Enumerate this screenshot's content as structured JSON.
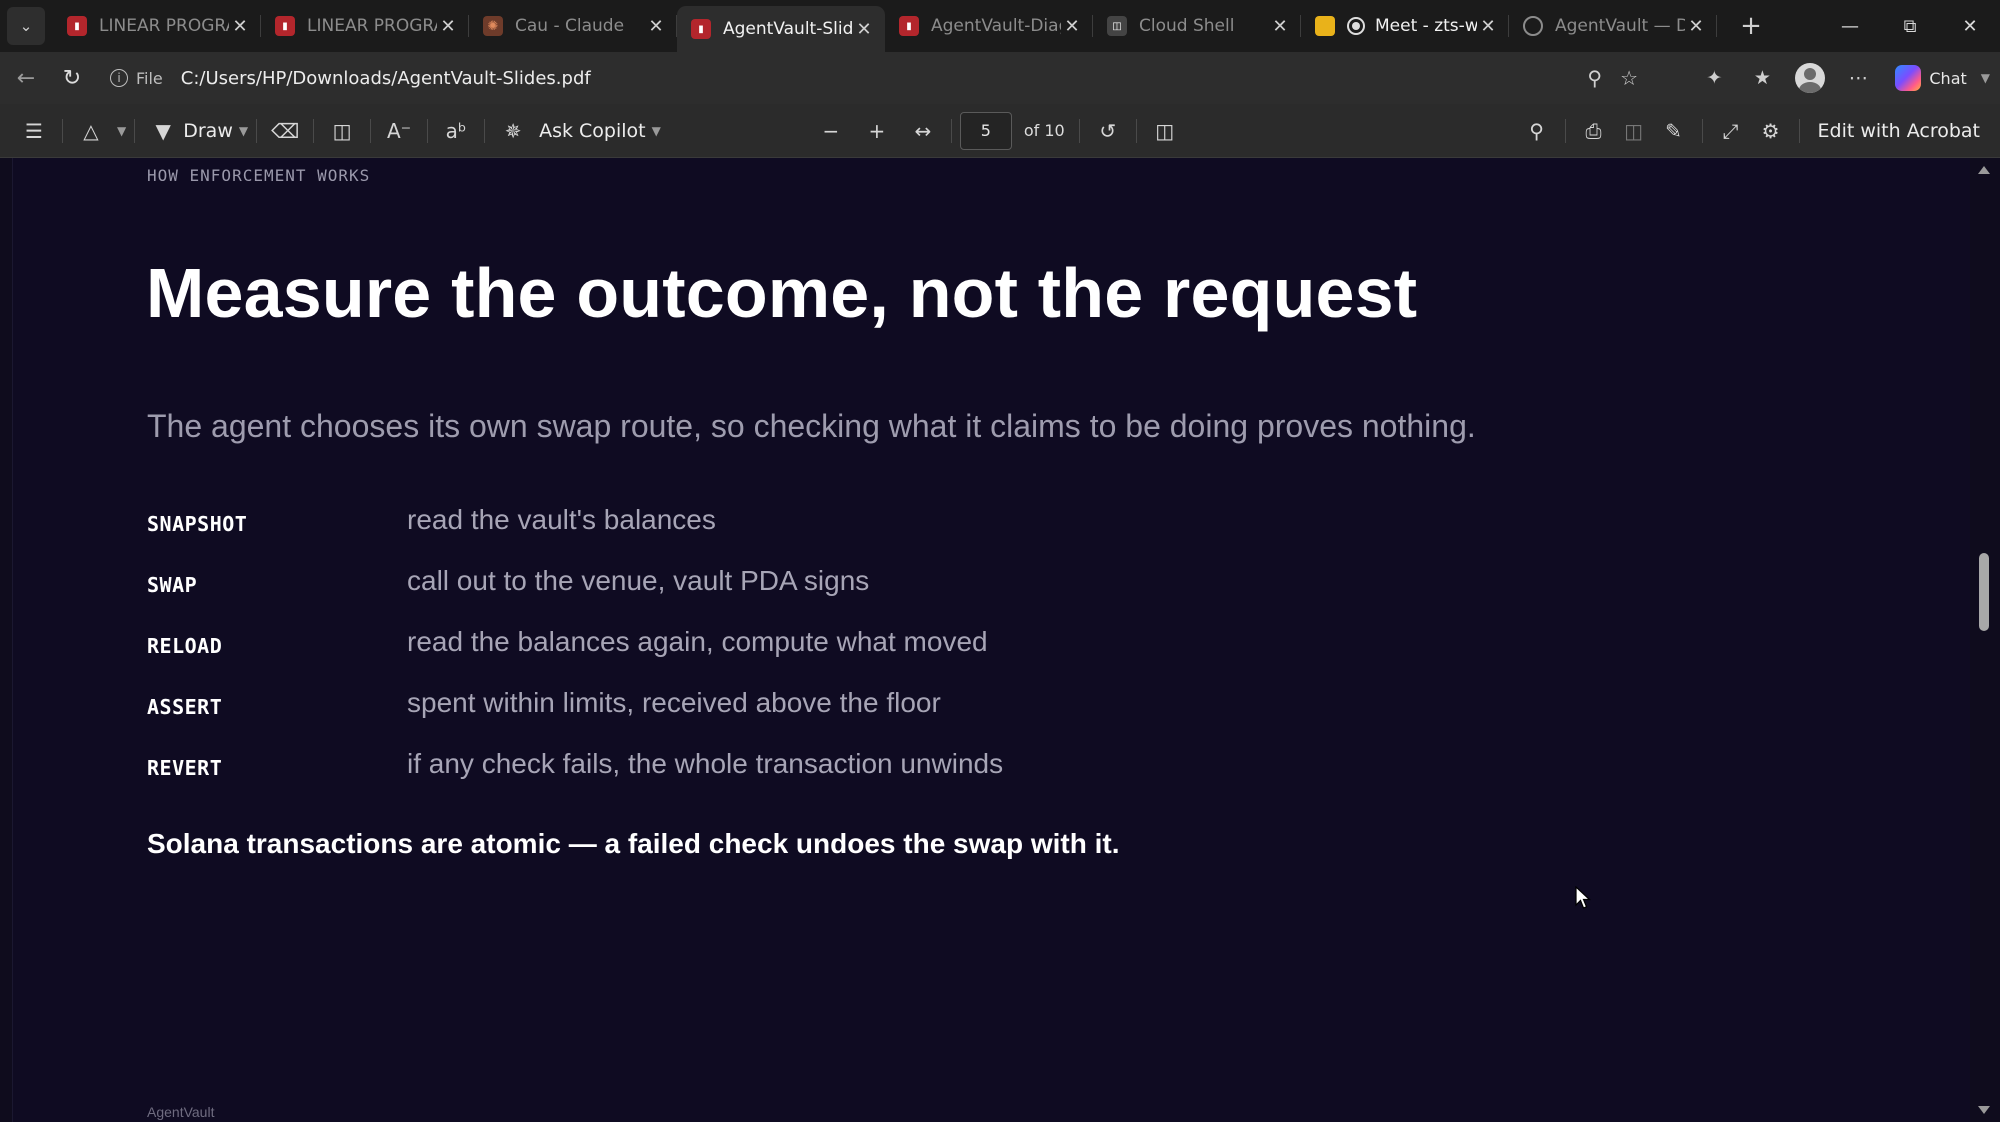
{
  "tabs": [
    {
      "label": "LINEAR PROGRAMI",
      "icon": "pdf-icon",
      "active": false
    },
    {
      "label": "LINEAR PROGRAMI",
      "icon": "pdf-icon",
      "active": false
    },
    {
      "label": "Cau - Claude",
      "icon": "claude-icon",
      "active": false
    },
    {
      "label": "AgentVault-Slides.p",
      "icon": "pdf-icon",
      "active": true
    },
    {
      "label": "AgentVault-Diagra",
      "icon": "pdf-icon",
      "active": false
    },
    {
      "label": "Cloud Shell",
      "icon": "cloud-shell-icon",
      "active": false
    },
    {
      "label": "Meet - zts-wpf",
      "icon": "meet-icon",
      "active": false,
      "recording": true
    },
    {
      "label": "AgentVault — DCA",
      "icon": "globe-icon",
      "active": false
    }
  ],
  "address_bar": {
    "site_label": "File",
    "url": "C:/Users/HP/Downloads/AgentVault-Slides.pdf",
    "chat_label": "Chat"
  },
  "pdf_toolbar": {
    "draw_label": "Draw",
    "ask_copilot_label": "Ask Copilot",
    "current_page": "5",
    "page_total": "of 10",
    "edit_acrobat_label": "Edit with Acrobat"
  },
  "slide": {
    "eyebrow": "HOW ENFORCEMENT WORKS",
    "title": "Measure the outcome, not the request",
    "subtitle": "The agent chooses its own swap route, so checking what it claims to be doing proves nothing.",
    "steps": [
      {
        "key": "SNAPSHOT",
        "desc": "read the vault's balances"
      },
      {
        "key": "SWAP",
        "desc": "call out to the venue, vault PDA signs"
      },
      {
        "key": "RELOAD",
        "desc": "read the balances again, compute what moved"
      },
      {
        "key": "ASSERT",
        "desc": "spent within limits, received above the floor"
      },
      {
        "key": "REVERT",
        "desc": "if any check fails, the whole transaction unwinds"
      }
    ],
    "closing": "Solana transactions are atomic — a failed check undoes the swap with it.",
    "footer": "AgentVault"
  },
  "colors": {
    "page_background": "#0f0b22",
    "title": "#ffffff",
    "body_text": "#a7a5b6",
    "pdf_icon": "#b3262c",
    "chrome_dark": "#1b1b1b"
  }
}
